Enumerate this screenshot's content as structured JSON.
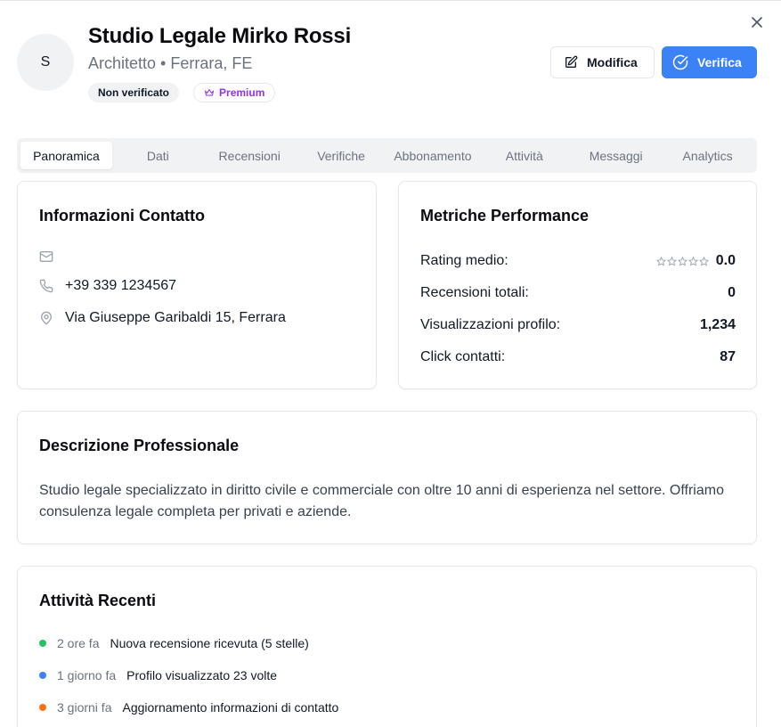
{
  "header": {
    "avatar_initial": "S",
    "title": "Studio Legale Mirko Rossi",
    "subtitle": "Architetto • Ferrara, FE",
    "badge_status": "Non verificato",
    "badge_premium": "Premium",
    "edit_label": "Modifica",
    "verify_label": "Verifica",
    "close_icon": "close-icon"
  },
  "colors": {
    "primary": "#3b82f6",
    "premium": "#9333ea",
    "green": "#22c55e",
    "blue": "#3b82f6",
    "orange": "#f97316"
  },
  "tabs": [
    {
      "label": "Panoramica",
      "active": true
    },
    {
      "label": "Dati"
    },
    {
      "label": "Recensioni"
    },
    {
      "label": "Verifiche"
    },
    {
      "label": "Abbonamento"
    },
    {
      "label": "Attività"
    },
    {
      "label": "Messaggi"
    },
    {
      "label": "Analytics"
    }
  ],
  "contact": {
    "title": "Informazioni Contatto",
    "email": "",
    "phone": "+39 339 1234567",
    "address": "Via Giuseppe Garibaldi 15, Ferrara"
  },
  "metrics": {
    "title": "Metriche Performance",
    "rating_label": "Rating medio:",
    "rating_value": "0.0",
    "rating_stars": 0,
    "reviews_label": "Recensioni totali:",
    "reviews_value": "0",
    "views_label": "Visualizzazioni profilo:",
    "views_value": "1,234",
    "clicks_label": "Click contatti:",
    "clicks_value": "87"
  },
  "description": {
    "title": "Descrizione Professionale",
    "text": "Studio legale specializzato in diritto civile e commerciale con oltre 10 anni di esperienza nel settore. Offriamo consulenza legale completa per privati e aziende."
  },
  "activity": {
    "title": "Attività Recenti",
    "items": [
      {
        "time": "2 ore fa",
        "text": "Nuova recensione ricevuta (5 stelle)",
        "color": "#22c55e"
      },
      {
        "time": "1 giorno fa",
        "text": "Profilo visualizzato 23 volte",
        "color": "#3b82f6"
      },
      {
        "time": "3 giorni fa",
        "text": "Aggiornamento informazioni di contatto",
        "color": "#f97316"
      }
    ]
  }
}
